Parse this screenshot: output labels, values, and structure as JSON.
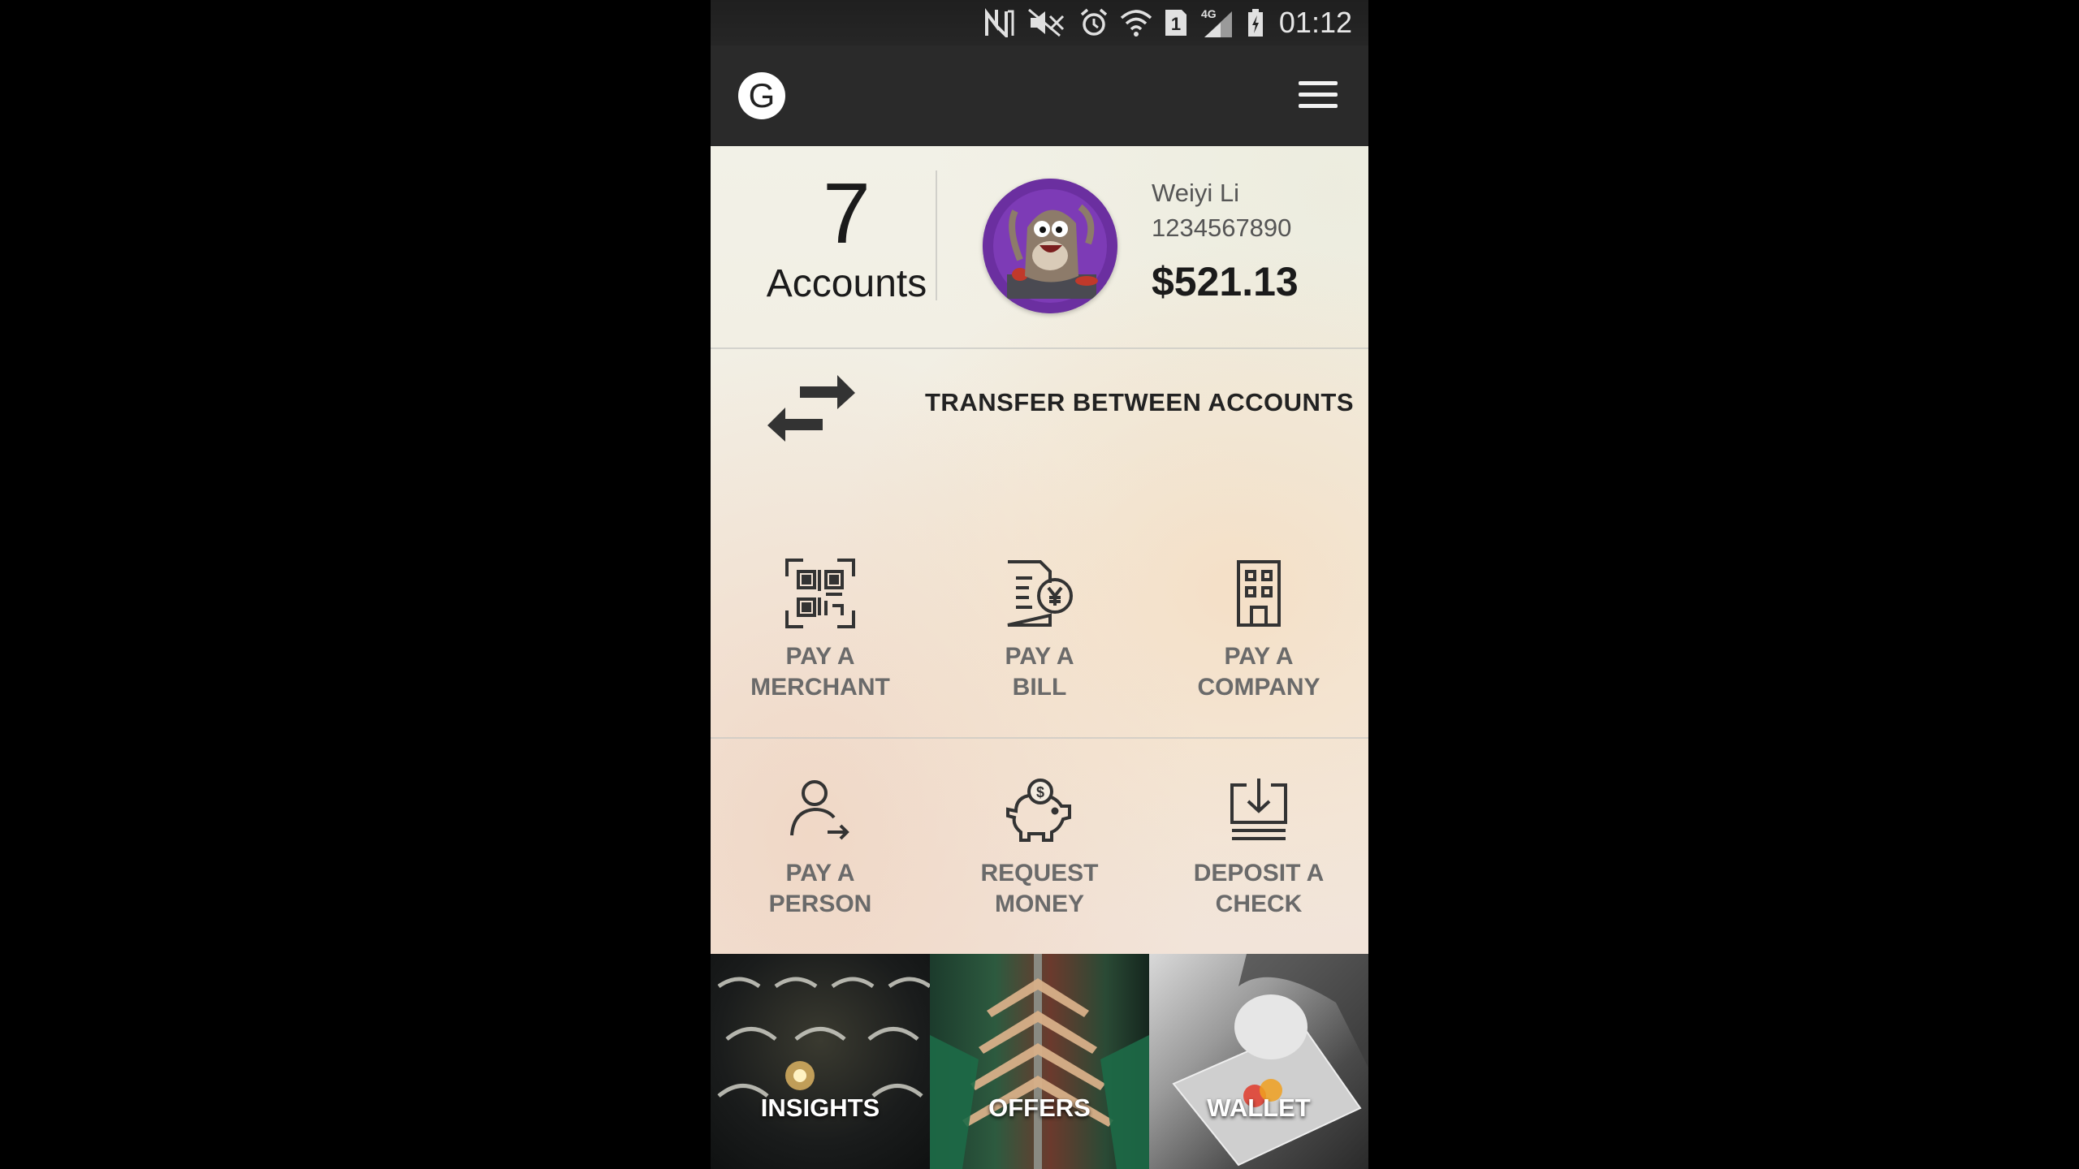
{
  "status_bar": {
    "time": "01:12",
    "network": "4G",
    "sim_slot": "1",
    "icons": [
      "nfc-icon",
      "mute-icon",
      "alarm-icon",
      "wifi-icon",
      "sim-icon",
      "signal-icon",
      "battery-charging-icon"
    ]
  },
  "app_bar": {
    "logo_letter": "G",
    "menu_icon": "hamburger-menu-icon"
  },
  "summary": {
    "accounts_count": "7",
    "accounts_label": "Accounts",
    "user_name": "Weiyi Li",
    "user_phone": "1234567890",
    "balance": "$521.13"
  },
  "transfer": {
    "label": "TRANSFER BETWEEN ACCOUNTS",
    "icon": "swap-arrows-icon"
  },
  "actions": [
    {
      "line1": "PAY A",
      "line2": "MERCHANT",
      "icon": "qr-code-icon"
    },
    {
      "line1": "PAY A",
      "line2": "BILL",
      "icon": "bill-yen-icon"
    },
    {
      "line1": "PAY A",
      "line2": "COMPANY",
      "icon": "building-icon"
    },
    {
      "line1": "PAY A",
      "line2": "PERSON",
      "icon": "person-arrow-icon"
    },
    {
      "line1": "REQUEST",
      "line2": "MONEY",
      "icon": "piggy-bank-icon"
    },
    {
      "line1": "DEPOSIT A",
      "line2": "CHECK",
      "icon": "deposit-check-icon"
    }
  ],
  "tiles": [
    {
      "label": "INSIGHTS"
    },
    {
      "label": "OFFERS"
    },
    {
      "label": "WALLET"
    }
  ],
  "colors": {
    "app_bar": "#2a2a2a",
    "content_bg": "#f3ece0",
    "action_label": "#6a6a6a",
    "text_dark": "#1b1b1b"
  }
}
